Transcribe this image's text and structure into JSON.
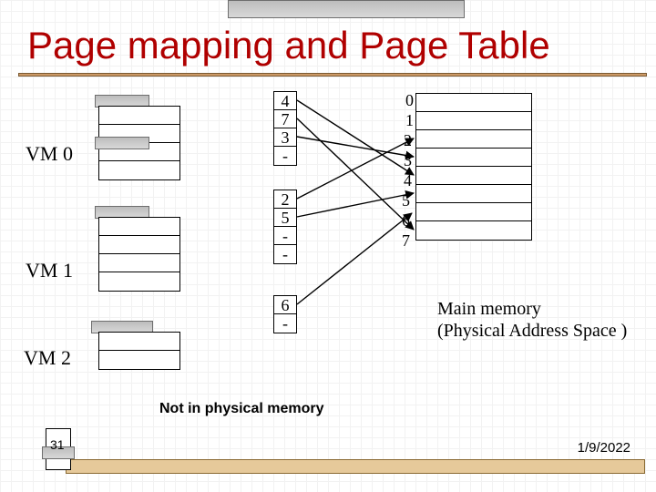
{
  "title": "Page mapping and Page Table",
  "vms": [
    {
      "label": "VM 0",
      "page_table": [
        "4",
        "7",
        "3",
        "-"
      ]
    },
    {
      "label": "VM 1",
      "page_table": [
        "2",
        "5",
        "-",
        "-"
      ]
    },
    {
      "label": "VM 2",
      "page_table": [
        "6",
        "-"
      ]
    }
  ],
  "memory": {
    "frames": [
      "0",
      "1",
      "2",
      "3",
      "4",
      "5",
      "6",
      "7"
    ],
    "caption_line1": "Main memory",
    "caption_line2": " (Physical Address Space )"
  },
  "notes": {
    "not_in_mem": "Not in physical memory"
  },
  "footer": {
    "slide_number": "31",
    "date": "1/9/2022"
  }
}
